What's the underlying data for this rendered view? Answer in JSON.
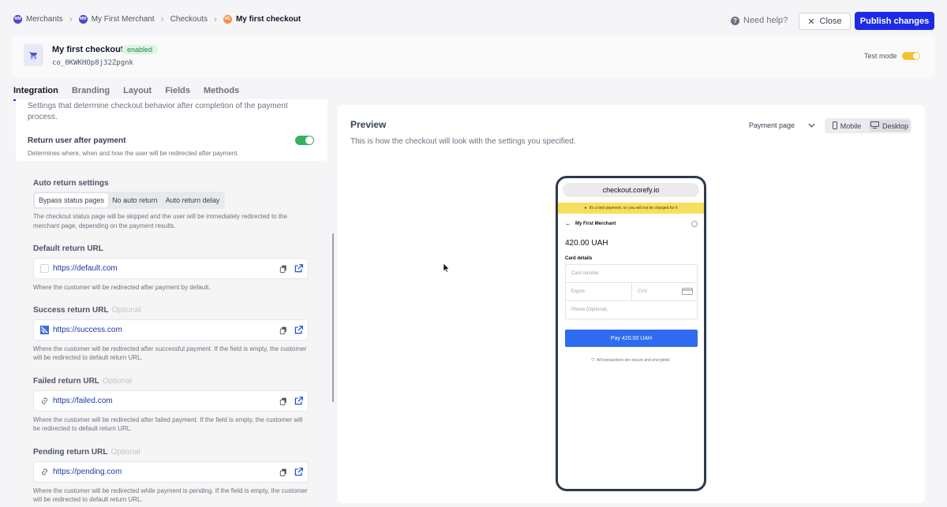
{
  "breadcrumb": [
    {
      "badge": "MM",
      "label": "Merchants",
      "color": "#4f46c9"
    },
    {
      "badge": "MM",
      "label": "My First Merchant",
      "color": "#4f46c9"
    },
    {
      "label": "Checkouts"
    },
    {
      "badge": "MC",
      "label": "My first checkout",
      "color": "#f28c4a"
    }
  ],
  "topbar": {
    "help_label": "Need help?",
    "close_label": "Close",
    "publish_label": "Publish changes"
  },
  "checkout": {
    "title": "My first checkout",
    "status": "enabled",
    "id": "co_0KWKHOp8j32Zpgnk",
    "test_mode_label": "Test mode",
    "test_mode_on": true
  },
  "tabs": [
    "Integration",
    "Branding",
    "Layout",
    "Fields",
    "Methods"
  ],
  "active_tab": "Integration",
  "settings": {
    "intro": "Settings that determine checkout behavior after completion of the payment process.",
    "return_user_title": "Return user after payment",
    "return_user_desc": "Determines where, when and how the user will be redirected after payment.",
    "return_user_on": true,
    "auto_return_title": "Auto return settings",
    "auto_return_options": [
      "Bypass status pages",
      "No auto return",
      "Auto return delay"
    ],
    "auto_return_selected": "Bypass status pages",
    "auto_return_desc": "The checkout status page will be skipped and the user will be immediately redirected to the merchant page, depending on the payment results."
  },
  "return_urls": [
    {
      "label": "Default return URL",
      "optional": "",
      "value": "https://default.com",
      "help": "Where the customer will be redirected after payment by default."
    },
    {
      "label": "Success return URL",
      "optional": "Optional",
      "value": "https://success.com",
      "help": "Where the customer will be redirected after successful payment. If the field is empty, the customer will be redirected to default return URL."
    },
    {
      "label": "Failed return URL",
      "optional": "Optional",
      "value": "https://failed.com",
      "help": "Where the customer will be redirected after failed payment. If the field is empty, the customer will be redirected to default return URL."
    },
    {
      "label": "Pending return URL",
      "optional": "Optional",
      "value": "https://pending.com",
      "help": "Where the customer will be redirected while payment is pending. If the field is empty, the customer will be redirected to default return URL."
    }
  ],
  "preview": {
    "title": "Preview",
    "desc": "This is how the checkout will look with the settings you specified.",
    "page_select": "Payment page",
    "device_options": [
      "Mobile",
      "Desktop"
    ],
    "device_selected": "Desktop",
    "phone": {
      "url": "checkout.corefy.io",
      "test_banner": "It's a test payment, so you will not be charged for it",
      "merchant": "My First Merchant",
      "amount": "420.00 UAH",
      "card_details_label": "Card details",
      "card_number_placeholder": "Card number",
      "expire_placeholder": "Expire",
      "cvv_placeholder": "CVV",
      "phone_placeholder": "Phone (Optional)",
      "pay_label": "Pay 420.00 UAH",
      "secure_note": "All transactions are secure and encrypted."
    }
  },
  "icons": {
    "copy": "copy-icon",
    "external": "external-link-icon",
    "cart": "cart-icon",
    "link": "link-icon"
  },
  "colors": {
    "primary": "#1d2be6",
    "toggle_green": "#35b15e",
    "test_yellow": "#f2c230",
    "pay_blue": "#2e6bf0"
  }
}
